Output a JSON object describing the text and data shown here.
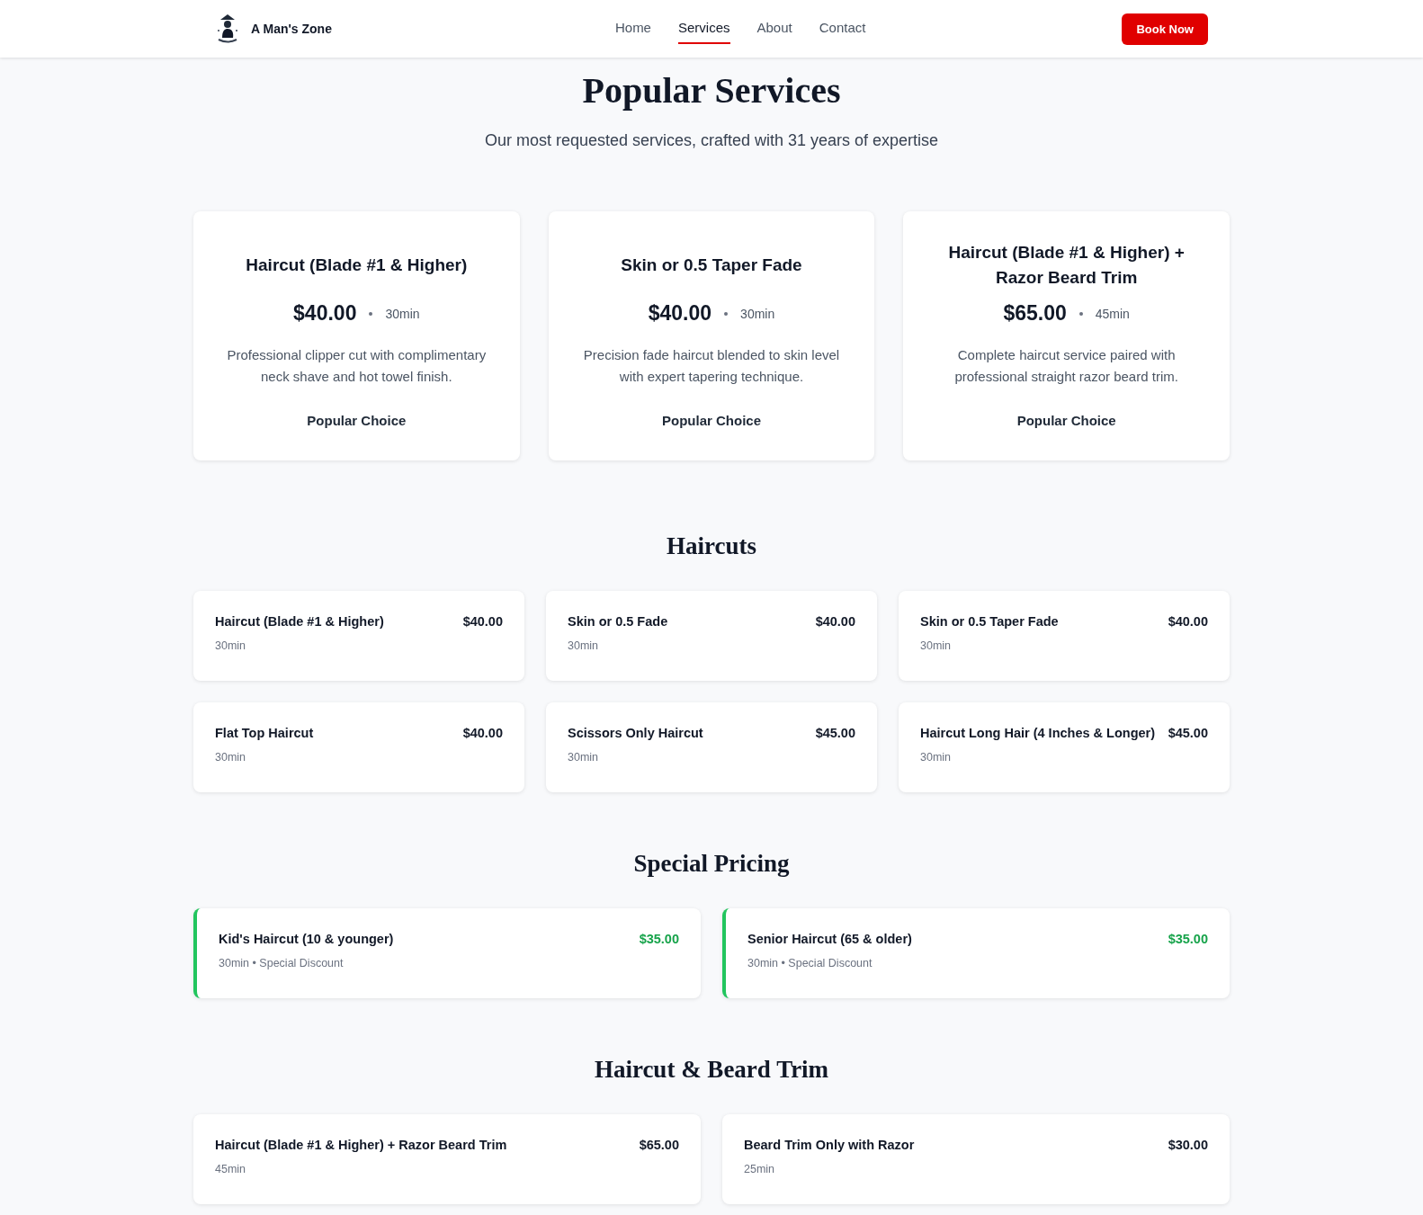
{
  "header": {
    "brand": "A Man's Zone",
    "nav": [
      {
        "label": "Home",
        "selected": false
      },
      {
        "label": "Services",
        "selected": true
      },
      {
        "label": "About",
        "selected": false
      },
      {
        "label": "Contact",
        "selected": false
      }
    ],
    "book_button": "Book Now"
  },
  "hero": {
    "title": "Popular Services",
    "subtitle": "Our most requested services, crafted with 31 years of expertise"
  },
  "popular_cards": [
    {
      "title": "Haircut (Blade #1 & Higher)",
      "price": "$40.00",
      "duration": "30min",
      "description": "Professional clipper cut with complimentary neck shave and hot towel finish.",
      "badge": "Popular Choice"
    },
    {
      "title": "Skin or 0.5 Taper Fade",
      "price": "$40.00",
      "duration": "30min",
      "description": "Precision fade haircut blended to skin level with expert tapering technique.",
      "badge": "Popular Choice"
    },
    {
      "title": "Haircut (Blade #1 & Higher) + Razor Beard Trim",
      "price": "$65.00",
      "duration": "45min",
      "description": "Complete haircut service paired with professional straight razor beard trim.",
      "badge": "Popular Choice"
    }
  ],
  "sections": [
    {
      "title": "Haircuts",
      "kind": "regular",
      "items": [
        {
          "name": "Haircut (Blade #1 & Higher)",
          "price": "$40.00",
          "detail": "30min"
        },
        {
          "name": "Skin or 0.5 Fade",
          "price": "$40.00",
          "detail": "30min"
        },
        {
          "name": "Skin or 0.5 Taper Fade",
          "price": "$40.00",
          "detail": "30min"
        },
        {
          "name": "Flat Top Haircut",
          "price": "$40.00",
          "detail": "30min"
        },
        {
          "name": "Scissors Only Haircut",
          "price": "$45.00",
          "detail": "30min"
        },
        {
          "name": "Haircut Long Hair (4 Inches & Longer)",
          "price": "$45.00",
          "detail": "30min"
        }
      ]
    },
    {
      "title": "Special Pricing",
      "kind": "special",
      "items": [
        {
          "name": "Kid's Haircut (10 & younger)",
          "price": "$35.00",
          "detail": "30min • Special Discount"
        },
        {
          "name": "Senior Haircut (65 & older)",
          "price": "$35.00",
          "detail": "30min • Special Discount"
        }
      ]
    },
    {
      "title": "Haircut & Beard Trim",
      "kind": "regular",
      "items": [
        {
          "name": "Haircut (Blade #1 & Higher) + Razor Beard Trim",
          "price": "$65.00",
          "detail": "45min"
        },
        {
          "name": "Beard Trim Only with Razor",
          "price": "$30.00",
          "detail": "25min"
        }
      ]
    }
  ]
}
